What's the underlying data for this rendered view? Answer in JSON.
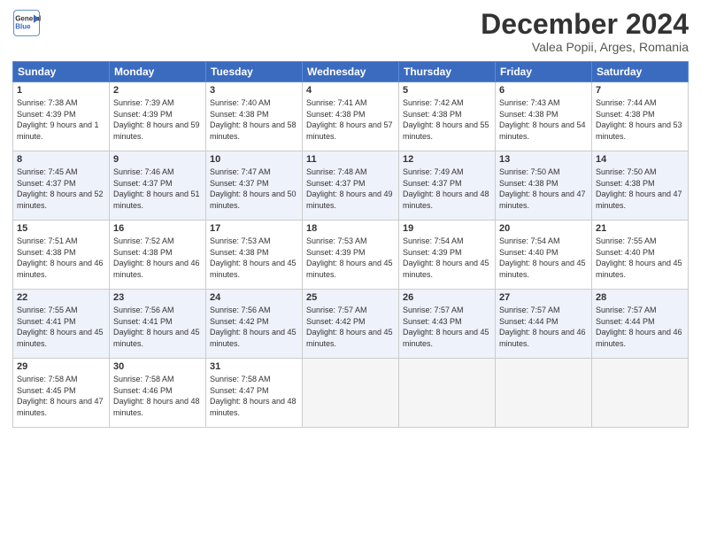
{
  "header": {
    "logo_line1": "General",
    "logo_line2": "Blue",
    "month": "December 2024",
    "location": "Valea Popii, Arges, Romania"
  },
  "weekdays": [
    "Sunday",
    "Monday",
    "Tuesday",
    "Wednesday",
    "Thursday",
    "Friday",
    "Saturday"
  ],
  "weeks": [
    [
      {
        "day": "1",
        "sunrise": "Sunrise: 7:38 AM",
        "sunset": "Sunset: 4:39 PM",
        "daylight": "Daylight: 9 hours and 1 minute."
      },
      {
        "day": "2",
        "sunrise": "Sunrise: 7:39 AM",
        "sunset": "Sunset: 4:39 PM",
        "daylight": "Daylight: 8 hours and 59 minutes."
      },
      {
        "day": "3",
        "sunrise": "Sunrise: 7:40 AM",
        "sunset": "Sunset: 4:38 PM",
        "daylight": "Daylight: 8 hours and 58 minutes."
      },
      {
        "day": "4",
        "sunrise": "Sunrise: 7:41 AM",
        "sunset": "Sunset: 4:38 PM",
        "daylight": "Daylight: 8 hours and 57 minutes."
      },
      {
        "day": "5",
        "sunrise": "Sunrise: 7:42 AM",
        "sunset": "Sunset: 4:38 PM",
        "daylight": "Daylight: 8 hours and 55 minutes."
      },
      {
        "day": "6",
        "sunrise": "Sunrise: 7:43 AM",
        "sunset": "Sunset: 4:38 PM",
        "daylight": "Daylight: 8 hours and 54 minutes."
      },
      {
        "day": "7",
        "sunrise": "Sunrise: 7:44 AM",
        "sunset": "Sunset: 4:38 PM",
        "daylight": "Daylight: 8 hours and 53 minutes."
      }
    ],
    [
      {
        "day": "8",
        "sunrise": "Sunrise: 7:45 AM",
        "sunset": "Sunset: 4:37 PM",
        "daylight": "Daylight: 8 hours and 52 minutes."
      },
      {
        "day": "9",
        "sunrise": "Sunrise: 7:46 AM",
        "sunset": "Sunset: 4:37 PM",
        "daylight": "Daylight: 8 hours and 51 minutes."
      },
      {
        "day": "10",
        "sunrise": "Sunrise: 7:47 AM",
        "sunset": "Sunset: 4:37 PM",
        "daylight": "Daylight: 8 hours and 50 minutes."
      },
      {
        "day": "11",
        "sunrise": "Sunrise: 7:48 AM",
        "sunset": "Sunset: 4:37 PM",
        "daylight": "Daylight: 8 hours and 49 minutes."
      },
      {
        "day": "12",
        "sunrise": "Sunrise: 7:49 AM",
        "sunset": "Sunset: 4:37 PM",
        "daylight": "Daylight: 8 hours and 48 minutes."
      },
      {
        "day": "13",
        "sunrise": "Sunrise: 7:50 AM",
        "sunset": "Sunset: 4:38 PM",
        "daylight": "Daylight: 8 hours and 47 minutes."
      },
      {
        "day": "14",
        "sunrise": "Sunrise: 7:50 AM",
        "sunset": "Sunset: 4:38 PM",
        "daylight": "Daylight: 8 hours and 47 minutes."
      }
    ],
    [
      {
        "day": "15",
        "sunrise": "Sunrise: 7:51 AM",
        "sunset": "Sunset: 4:38 PM",
        "daylight": "Daylight: 8 hours and 46 minutes."
      },
      {
        "day": "16",
        "sunrise": "Sunrise: 7:52 AM",
        "sunset": "Sunset: 4:38 PM",
        "daylight": "Daylight: 8 hours and 46 minutes."
      },
      {
        "day": "17",
        "sunrise": "Sunrise: 7:53 AM",
        "sunset": "Sunset: 4:38 PM",
        "daylight": "Daylight: 8 hours and 45 minutes."
      },
      {
        "day": "18",
        "sunrise": "Sunrise: 7:53 AM",
        "sunset": "Sunset: 4:39 PM",
        "daylight": "Daylight: 8 hours and 45 minutes."
      },
      {
        "day": "19",
        "sunrise": "Sunrise: 7:54 AM",
        "sunset": "Sunset: 4:39 PM",
        "daylight": "Daylight: 8 hours and 45 minutes."
      },
      {
        "day": "20",
        "sunrise": "Sunrise: 7:54 AM",
        "sunset": "Sunset: 4:40 PM",
        "daylight": "Daylight: 8 hours and 45 minutes."
      },
      {
        "day": "21",
        "sunrise": "Sunrise: 7:55 AM",
        "sunset": "Sunset: 4:40 PM",
        "daylight": "Daylight: 8 hours and 45 minutes."
      }
    ],
    [
      {
        "day": "22",
        "sunrise": "Sunrise: 7:55 AM",
        "sunset": "Sunset: 4:41 PM",
        "daylight": "Daylight: 8 hours and 45 minutes."
      },
      {
        "day": "23",
        "sunrise": "Sunrise: 7:56 AM",
        "sunset": "Sunset: 4:41 PM",
        "daylight": "Daylight: 8 hours and 45 minutes."
      },
      {
        "day": "24",
        "sunrise": "Sunrise: 7:56 AM",
        "sunset": "Sunset: 4:42 PM",
        "daylight": "Daylight: 8 hours and 45 minutes."
      },
      {
        "day": "25",
        "sunrise": "Sunrise: 7:57 AM",
        "sunset": "Sunset: 4:42 PM",
        "daylight": "Daylight: 8 hours and 45 minutes."
      },
      {
        "day": "26",
        "sunrise": "Sunrise: 7:57 AM",
        "sunset": "Sunset: 4:43 PM",
        "daylight": "Daylight: 8 hours and 45 minutes."
      },
      {
        "day": "27",
        "sunrise": "Sunrise: 7:57 AM",
        "sunset": "Sunset: 4:44 PM",
        "daylight": "Daylight: 8 hours and 46 minutes."
      },
      {
        "day": "28",
        "sunrise": "Sunrise: 7:57 AM",
        "sunset": "Sunset: 4:44 PM",
        "daylight": "Daylight: 8 hours and 46 minutes."
      }
    ],
    [
      {
        "day": "29",
        "sunrise": "Sunrise: 7:58 AM",
        "sunset": "Sunset: 4:45 PM",
        "daylight": "Daylight: 8 hours and 47 minutes."
      },
      {
        "day": "30",
        "sunrise": "Sunrise: 7:58 AM",
        "sunset": "Sunset: 4:46 PM",
        "daylight": "Daylight: 8 hours and 48 minutes."
      },
      {
        "day": "31",
        "sunrise": "Sunrise: 7:58 AM",
        "sunset": "Sunset: 4:47 PM",
        "daylight": "Daylight: 8 hours and 48 minutes."
      },
      null,
      null,
      null,
      null
    ]
  ]
}
